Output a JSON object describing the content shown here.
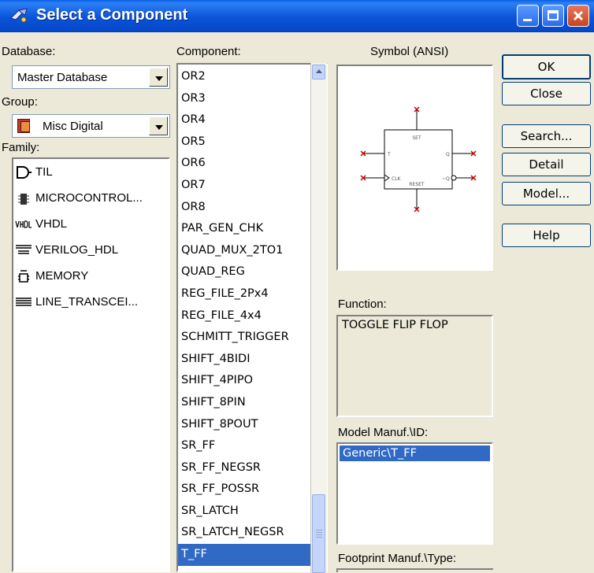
{
  "window": {
    "title": "Select a Component"
  },
  "database": {
    "label": "Database:",
    "value": "Master Database"
  },
  "group": {
    "label": "Group:",
    "value": "Misc Digital"
  },
  "family": {
    "label": "Family:",
    "items": [
      {
        "label": "TIL",
        "icon": "gate-icon"
      },
      {
        "label": "MICROCONTROL...",
        "icon": "chip-icon"
      },
      {
        "label": "VHDL",
        "icon": "vhdl-icon"
      },
      {
        "label": "VERILOG_HDL",
        "icon": "verilog-icon"
      },
      {
        "label": "MEMORY",
        "icon": "memory-icon"
      },
      {
        "label": "LINE_TRANSCEI...",
        "icon": "line-icon"
      }
    ]
  },
  "component": {
    "label": "Component:",
    "items": [
      "OR2",
      "OR3",
      "OR4",
      "OR5",
      "OR6",
      "OR7",
      "OR8",
      "PAR_GEN_CHK",
      "QUAD_MUX_2TO1",
      "QUAD_REG",
      "REG_FILE_2Px4",
      "REG_FILE_4x4",
      "SCHMITT_TRIGGER",
      "SHIFT_4BIDI",
      "SHIFT_4PIPO",
      "SHIFT_8PIN",
      "SHIFT_8POUT",
      "SR_FF",
      "SR_FF_NEGSR",
      "SR_FF_POSSR",
      "SR_LATCH",
      "SR_LATCH_NEGSR",
      "T_FF"
    ],
    "selected": "T_FF"
  },
  "symbol": {
    "label": "Symbol (ANSI)",
    "pins": {
      "set": "SET",
      "t": "T",
      "q": "Q",
      "clk": "CLK",
      "qbar": "~Q",
      "reset": "RESET"
    }
  },
  "function": {
    "label": "Function:",
    "value": "TOGGLE FLIP FLOP"
  },
  "model_manuf": {
    "label": "Model Manuf.\\ID:",
    "items": [
      "Generic\\T_FF"
    ]
  },
  "footprint": {
    "label": "Footprint Manuf.\\Type:"
  },
  "buttons": {
    "ok": "OK",
    "close": "Close",
    "search": "Search...",
    "detail_report": "Detail Report...",
    "model": "Model...",
    "help": "Help"
  },
  "colors": {
    "title_bar": "#0B54D8",
    "selection": "#316AC5",
    "dialog_bg": "#ECE9D8",
    "pin_red": "#CC0000"
  }
}
